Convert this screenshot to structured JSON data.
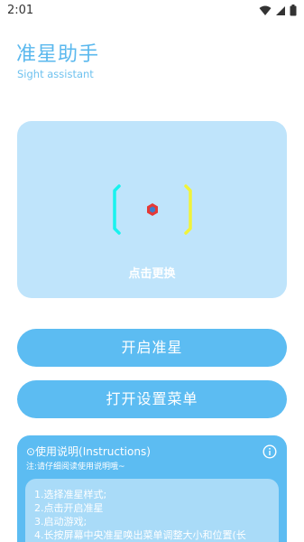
{
  "status_bar": {
    "time": "2:01",
    "icons": [
      "wifi-icon",
      "signal-icon",
      "battery-icon"
    ]
  },
  "app": {
    "title": "准星助手",
    "subtitle": "Sight assistant"
  },
  "preview": {
    "caption": "点击更换",
    "colors": {
      "card": "#bfe4fb",
      "left_bracket": "#19f2ee",
      "right_bracket": "#f1f33a",
      "center_outer": "#e53935",
      "center_inner": "#3d7cc9"
    }
  },
  "buttons": {
    "enable_label": "开启准星",
    "settings_label": "打开设置菜单"
  },
  "instructions": {
    "header": "⊙使用说明(Instructions)",
    "note": "注:请仔细阅读使用说明哦~",
    "steps": [
      "1.选择准星样式;",
      "2.点击开启准星",
      "3.启动游戏;",
      "4.长按屏幕中央准星唤出菜单调整大小和位置(长"
    ]
  },
  "colors": {
    "accent": "#5cbcf2",
    "title": "#5ab8ee"
  }
}
